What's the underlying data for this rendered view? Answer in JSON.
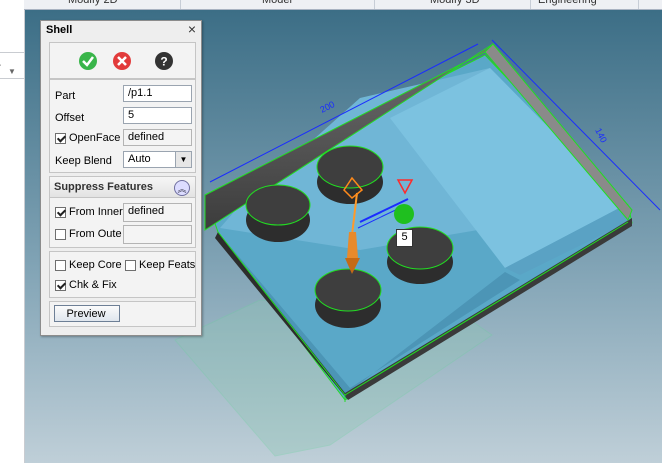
{
  "tabs": [
    "Modify 2D",
    "Model",
    "Modify 3D",
    "Engineering"
  ],
  "dialog": {
    "title": "Shell",
    "ok_icon": "check-circle-icon",
    "cancel_icon": "x-circle-icon",
    "help_icon": "help-circle-icon",
    "part_label": "Part",
    "part_value": "/p1.1",
    "offset_label": "Offset",
    "offset_value": "5",
    "openface_label": "OpenFace",
    "openface_checked": true,
    "openface_value": "defined",
    "keep_blend_label": "Keep Blend",
    "keep_blend_value": "Auto",
    "suppress_title": "Suppress Features",
    "from_inner_label": "From Inner",
    "from_inner_checked": true,
    "from_inner_value": "defined",
    "from_outer_label": "From Oute",
    "from_outer_checked": false,
    "from_outer_value": "",
    "keep_core_label": "Keep Core",
    "keep_core_checked": false,
    "keep_feats_label": "Keep Feats",
    "keep_feats_checked": false,
    "chk_fix_label": "Chk & Fix",
    "chk_fix_checked": true,
    "preview_label": "Preview"
  },
  "viewport": {
    "dim_length": "200",
    "dim_width": "140",
    "offset_tag": "5",
    "background_top": "#3c6e86",
    "background_bottom": "#bfcfd8",
    "part_color": "#5aa8c8",
    "edge_highlight": "#22dd22",
    "dimension_color": "#1a2cff"
  }
}
